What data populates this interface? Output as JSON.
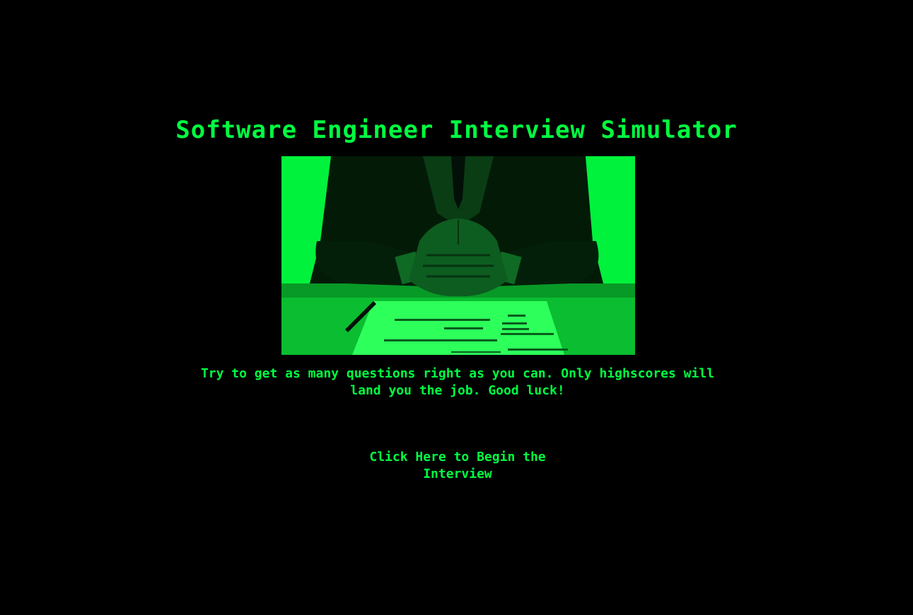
{
  "title": "Software Engineer Interview Simulator",
  "hero_image": {
    "description_icon": "interviewer-photo",
    "tint_color": "#00ff41"
  },
  "tagline": "Try to get as many questions right as you can. Only highscores will land you the job. Good luck!",
  "begin_button_label": "Click Here to Begin the Interview",
  "colors": {
    "background": "#000000",
    "text": "#00ff41",
    "image_bg": "#00f23c"
  }
}
